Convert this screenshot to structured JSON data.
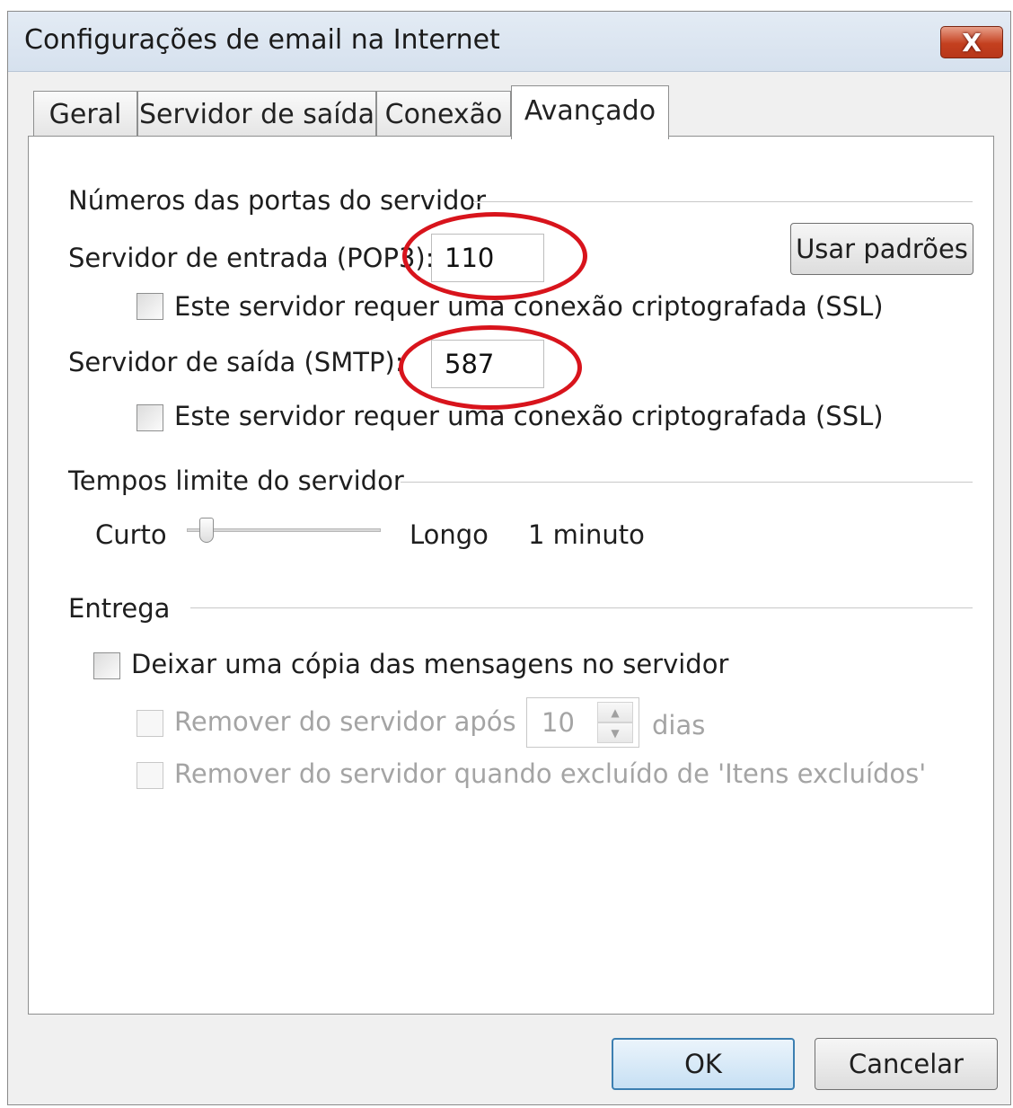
{
  "window": {
    "title": "Configurações de email na Internet",
    "close_glyph": "X"
  },
  "tabs": [
    {
      "label": "Geral"
    },
    {
      "label": "Servidor de saída"
    },
    {
      "label": "Conexão"
    },
    {
      "label": "Avançado",
      "selected": true
    }
  ],
  "ports": {
    "heading": "Números das portas do servidor",
    "incoming_label": "Servidor de entrada (POP3):",
    "incoming_value": "110",
    "incoming_ssl_label": "Este servidor requer uma conexão criptografada (SSL)",
    "incoming_ssl_checked": false,
    "use_defaults_label": "Usar padrões",
    "outgoing_label": "Servidor de saída (SMTP):",
    "outgoing_value": "587",
    "outgoing_ssl_label": "Este servidor requer uma conexão criptografada (SSL)",
    "outgoing_ssl_checked": false
  },
  "timeouts": {
    "heading": "Tempos limite do servidor",
    "short_label": "Curto",
    "long_label": "Longo",
    "value_label": "1 minuto",
    "slider_level": 0.1
  },
  "delivery": {
    "heading": "Entrega",
    "leave_copy_label": "Deixar uma cópia das mensagens no servidor",
    "leave_copy_checked": false,
    "remove_after_label": "Remover do servidor após",
    "remove_after_value": "10",
    "days_label": "dias",
    "remove_deleted_label": "Remover do servidor quando excluído de 'Itens excluídos'"
  },
  "buttons": {
    "ok": "OK",
    "cancel": "Cancelar"
  },
  "colors": {
    "annotation": "#d8141c",
    "default_button_border": "#3c7fb1"
  }
}
